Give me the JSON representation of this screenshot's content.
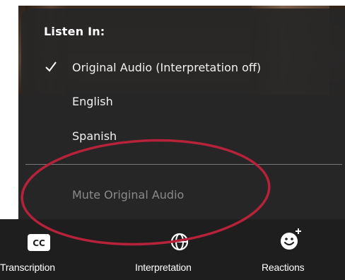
{
  "menu": {
    "title": "Listen In:",
    "items": [
      {
        "label": "Original Audio (Interpretation off)",
        "checked": true
      },
      {
        "label": "English",
        "checked": false
      },
      {
        "label": "Spanish",
        "checked": false
      }
    ],
    "mute_label": "Mute Original Audio"
  },
  "toolbar": {
    "buttons": [
      {
        "label": "Transcription",
        "icon": "cc-icon"
      },
      {
        "label": "Interpretation",
        "icon": "globe-icon"
      },
      {
        "label": "Reactions",
        "icon": "emoji-add-icon"
      }
    ]
  },
  "colors": {
    "menu_bg": "#262626",
    "toolbar_bg": "#1e1e1e",
    "annotation": "#b5223a",
    "disabled_text": "#8a8a8a"
  }
}
